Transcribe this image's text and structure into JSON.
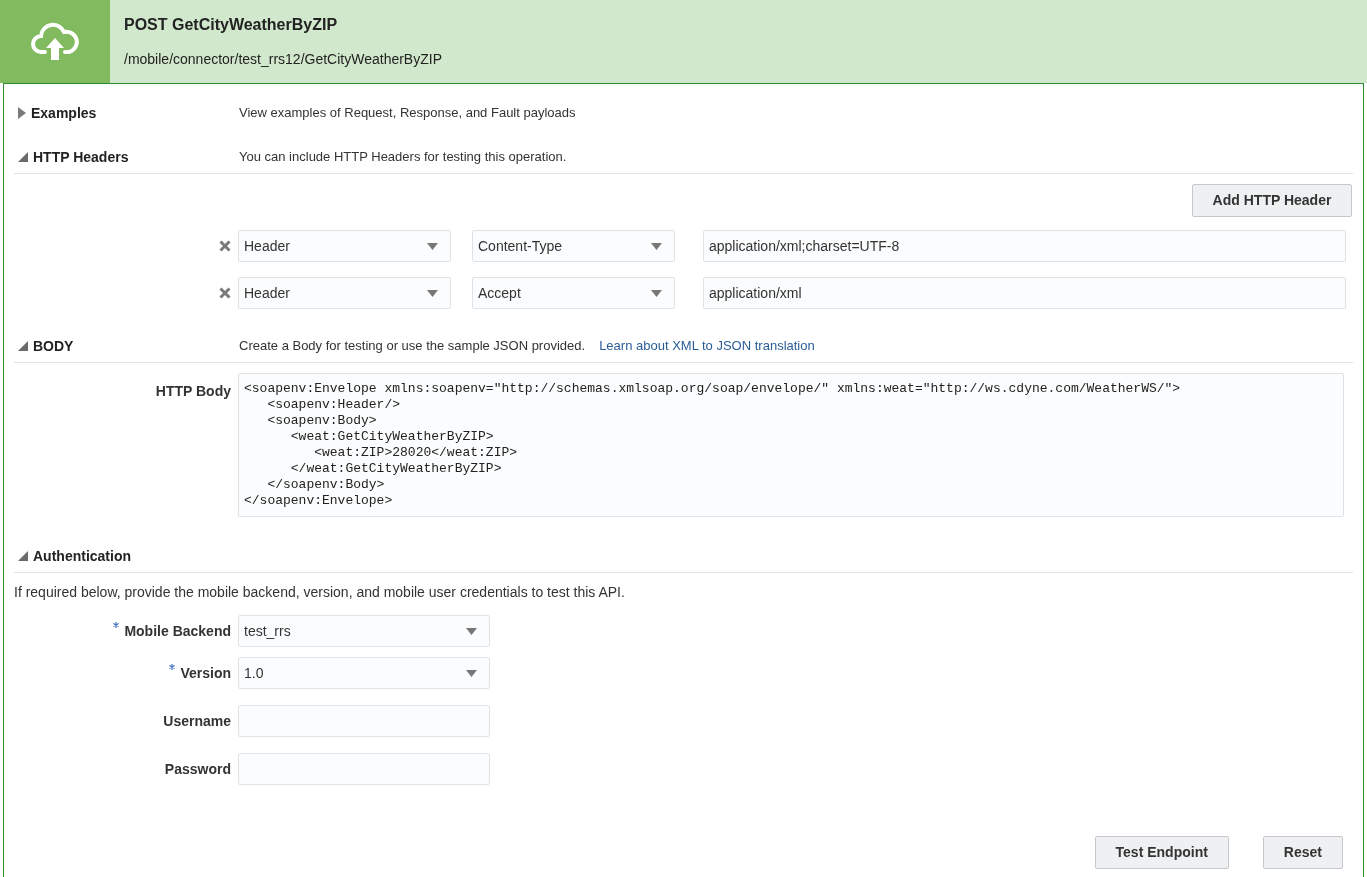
{
  "header": {
    "title": "POST GetCityWeatherByZIP",
    "path": "/mobile/connector/test_rrs12/GetCityWeatherByZIP"
  },
  "sections": {
    "examples": {
      "title": "Examples",
      "expanded": false,
      "description": "View examples of Request, Response, and Fault payloads"
    },
    "headers": {
      "title": "HTTP Headers",
      "expanded": true,
      "description": "You can include HTTP Headers for testing this operation.",
      "add_button": "Add HTTP Header",
      "rows": [
        {
          "type": "Header",
          "name": "Content-Type",
          "value": "application/xml;charset=UTF-8"
        },
        {
          "type": "Header",
          "name": "Accept",
          "value": "application/xml"
        }
      ]
    },
    "body": {
      "title": "BODY",
      "expanded": true,
      "description": "Create a Body for testing or use the sample JSON provided.",
      "link": "Learn about XML to JSON translation",
      "label": "HTTP Body",
      "lines": [
        "<soapenv:Envelope xmlns:soapenv=\"http://schemas.xmlsoap.org/soap/envelope/\" xmlns:weat=\"http://ws.cdyne.com/WeatherWS/\">",
        "   <soapenv:Header/>",
        "   <soapenv:Body>",
        "      <weat:GetCityWeatherByZIP>",
        "         <weat:ZIP>28020</weat:ZIP>",
        "      </weat:GetCityWeatherByZIP>",
        "   </soapenv:Body>",
        "</soapenv:Envelope>"
      ]
    },
    "auth": {
      "title": "Authentication",
      "expanded": true,
      "description": "If required below, provide the mobile backend, version, and mobile user credentials to test this API.",
      "fields": [
        {
          "kind": "select",
          "label": "Mobile Backend",
          "required": true,
          "value": "test_rrs"
        },
        {
          "kind": "select",
          "label": "Version",
          "required": true,
          "value": "1.0"
        },
        {
          "kind": "input",
          "label": "Username",
          "required": false
        },
        {
          "kind": "input",
          "label": "Password",
          "required": false
        }
      ]
    }
  },
  "buttons": [
    "Test Endpoint",
    "Reset"
  ]
}
